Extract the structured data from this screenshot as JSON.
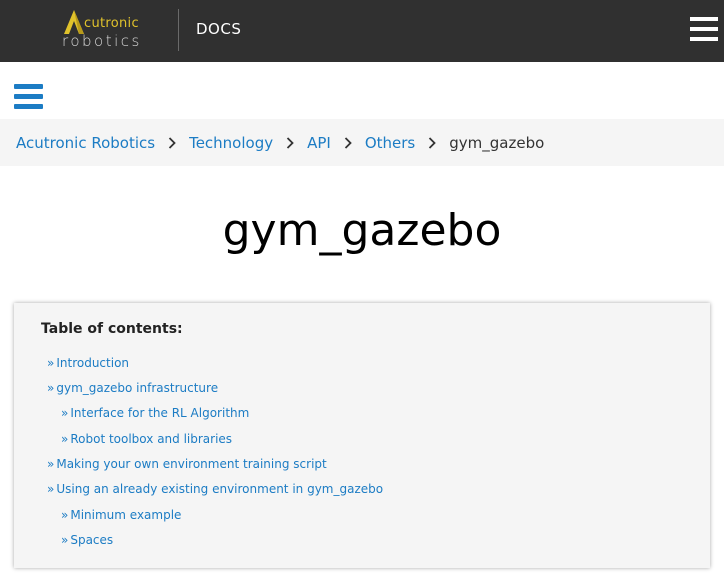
{
  "header": {
    "logo_top": "cutronic",
    "logo_bottom": "robotics",
    "docs_label": "DOCS"
  },
  "breadcrumb": {
    "items": [
      "Acutronic Robotics",
      "Technology",
      "API",
      "Others"
    ],
    "current": "gym_gazebo"
  },
  "page": {
    "title": "gym_gazebo"
  },
  "toc": {
    "heading": "Table of contents:",
    "arrow": "»",
    "items": [
      "Introduction",
      "gym_gazebo infrastructure",
      "Interface for the RL Algorithm",
      "Robot toolbox and libraries",
      "Making your own environment training script",
      "Using an already existing environment in gym_gazebo",
      "Minimum example",
      "Spaces"
    ]
  },
  "colors": {
    "topbar": "#303030",
    "link": "#1c7cc4",
    "logo_accent": "#e0c22b",
    "breadcrumb_bg": "#f5f5f5"
  }
}
